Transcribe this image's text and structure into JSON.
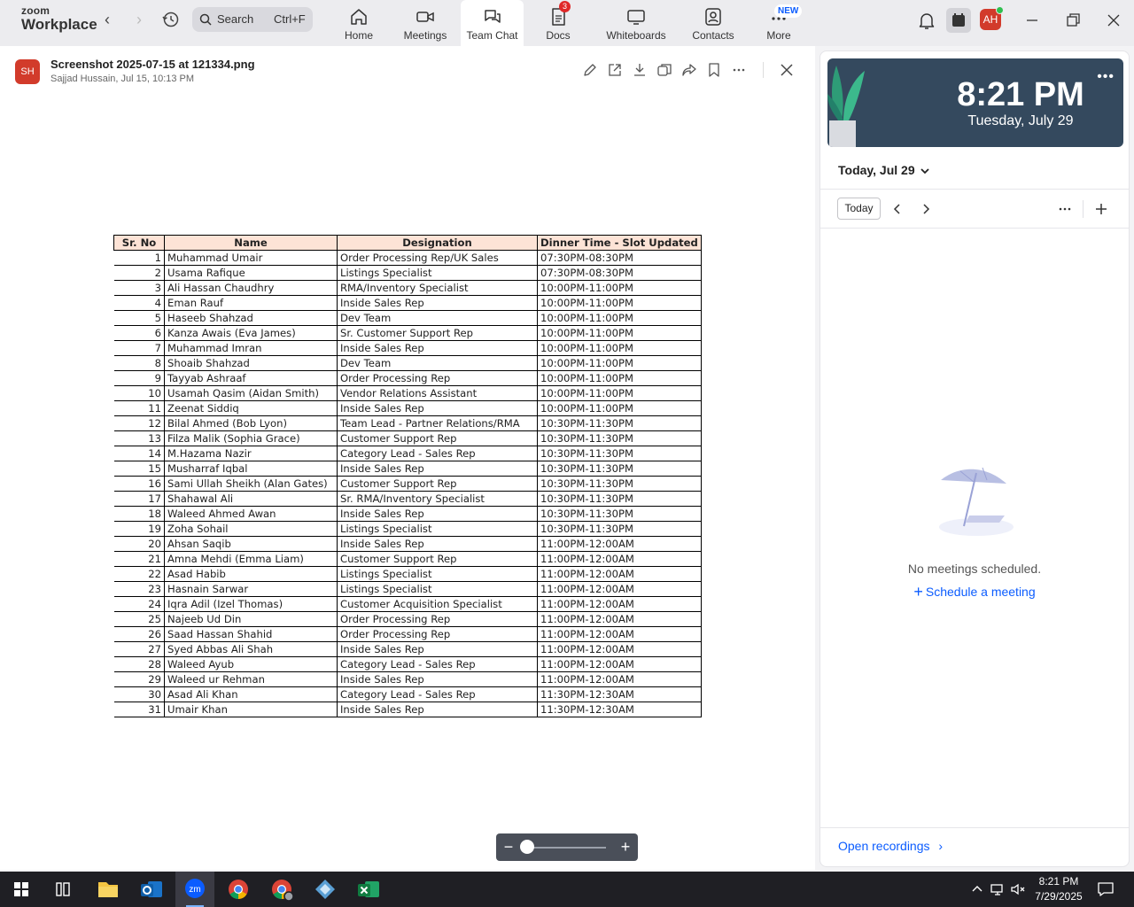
{
  "app": {
    "logo_line1": "zoom",
    "logo_line2": "Workplace",
    "search_placeholder": "Search",
    "search_shortcut": "Ctrl+F",
    "tabs": [
      {
        "label": "Home",
        "icon": "home-icon"
      },
      {
        "label": "Meetings",
        "icon": "video-camera-icon"
      },
      {
        "label": "Team Chat",
        "icon": "chat-bubbles-icon",
        "active": true
      },
      {
        "label": "Docs",
        "icon": "docs-icon",
        "badge": "3"
      },
      {
        "label": "Whiteboards",
        "icon": "whiteboard-icon"
      },
      {
        "label": "Contacts",
        "icon": "contacts-icon"
      },
      {
        "label": "More",
        "icon": "more-dots-icon",
        "badge": "NEW"
      }
    ],
    "user_initials": "AH",
    "accent": "#0b5cff"
  },
  "viewer": {
    "sender_initials": "SH",
    "file_name": "Screenshot 2025-07-15 at 121334.png",
    "file_meta": "Sajjad Hussain, Jul 15, 10:13 PM"
  },
  "table": {
    "headers": [
      "Sr. No",
      "Name",
      "Designation",
      "Dinner Time - Slot Updated"
    ],
    "rows": [
      [
        "1",
        "Muhammad Umair",
        "Order Processing Rep/UK Sales",
        "07:30PM-08:30PM"
      ],
      [
        "2",
        "Usama Rafique",
        "Listings Specialist",
        "07:30PM-08:30PM"
      ],
      [
        "3",
        "Ali Hassan Chaudhry",
        "RMA/Inventory Specialist",
        "10:00PM-11:00PM"
      ],
      [
        "4",
        "Eman Rauf",
        "Inside Sales Rep",
        "10:00PM-11:00PM"
      ],
      [
        "5",
        "Haseeb Shahzad",
        "Dev Team",
        "10:00PM-11:00PM"
      ],
      [
        "6",
        "Kanza Awais (Eva James)",
        "Sr. Customer Support Rep",
        "10:00PM-11:00PM"
      ],
      [
        "7",
        "Muhammad Imran",
        "Inside Sales Rep",
        "10:00PM-11:00PM"
      ],
      [
        "8",
        "Shoaib Shahzad",
        "Dev Team",
        "10:00PM-11:00PM"
      ],
      [
        "9",
        "Tayyab Ashraaf",
        "Order Processing Rep",
        "10:00PM-11:00PM"
      ],
      [
        "10",
        "Usamah Qasim (Aidan Smith)",
        "Vendor Relations Assistant",
        "10:00PM-11:00PM"
      ],
      [
        "11",
        "Zeenat Siddiq",
        "Inside Sales Rep",
        "10:00PM-11:00PM"
      ],
      [
        "12",
        "Bilal Ahmed (Bob Lyon)",
        "Team Lead - Partner Relations/RMA",
        "10:30PM-11:30PM"
      ],
      [
        "13",
        "Filza Malik (Sophia Grace)",
        "Customer Support Rep",
        "10:30PM-11:30PM"
      ],
      [
        "14",
        "M.Hazama Nazir",
        "Category Lead - Sales Rep",
        "10:30PM-11:30PM"
      ],
      [
        "15",
        "Musharraf Iqbal",
        "Inside Sales Rep",
        "10:30PM-11:30PM"
      ],
      [
        "16",
        "Sami Ullah Sheikh (Alan Gates)",
        "Customer Support Rep",
        "10:30PM-11:30PM"
      ],
      [
        "17",
        "Shahawal Ali",
        "Sr. RMA/Inventory Specialist",
        "10:30PM-11:30PM"
      ],
      [
        "18",
        "Waleed Ahmed Awan",
        "Inside Sales Rep",
        "10:30PM-11:30PM"
      ],
      [
        "19",
        "Zoha Sohail",
        "Listings Specialist",
        "10:30PM-11:30PM"
      ],
      [
        "20",
        "Ahsan Saqib",
        "Inside Sales Rep",
        "11:00PM-12:00AM"
      ],
      [
        "21",
        "Amna Mehdi (Emma Liam)",
        "Customer Support Rep",
        "11:00PM-12:00AM"
      ],
      [
        "22",
        "Asad Habib",
        "Listings Specialist",
        "11:00PM-12:00AM"
      ],
      [
        "23",
        "Hasnain Sarwar",
        "Listings Specialist",
        "11:00PM-12:00AM"
      ],
      [
        "24",
        "Iqra Adil (Izel Thomas)",
        "Customer Acquisition Specialist",
        "11:00PM-12:00AM"
      ],
      [
        "25",
        "Najeeb Ud Din",
        "Order Processing Rep",
        "11:00PM-12:00AM"
      ],
      [
        "26",
        "Saad Hassan Shahid",
        "Order Processing Rep",
        "11:00PM-12:00AM"
      ],
      [
        "27",
        "Syed Abbas Ali Shah",
        "Inside Sales Rep",
        "11:00PM-12:00AM"
      ],
      [
        "28",
        "Waleed Ayub",
        "Category Lead - Sales Rep",
        "11:00PM-12:00AM"
      ],
      [
        "29",
        "Waleed ur Rehman",
        "Inside Sales Rep",
        "11:00PM-12:00AM"
      ],
      [
        "30",
        "Asad Ali Khan",
        "Category Lead - Sales Rep",
        "11:30PM-12:30AM"
      ],
      [
        "31",
        "Umair Khan",
        "Inside Sales Rep",
        "11:30PM-12:30AM"
      ]
    ]
  },
  "calendar": {
    "time": "8:21 PM",
    "date": "Tuesday, July 29",
    "day_label": "Today, Jul 29",
    "today_button": "Today",
    "empty_text": "No meetings scheduled.",
    "schedule_link": "Schedule a meeting",
    "recordings_link": "Open recordings"
  },
  "taskbar": {
    "apps": [
      "windows-start-icon",
      "task-view-icon",
      "file-explorer-icon",
      "outlook-icon",
      "zoom-icon",
      "chrome-icon",
      "chrome-profile-icon",
      "app-diamond-icon",
      "excel-icon"
    ],
    "time": "8:21 PM",
    "date": "7/29/2025"
  }
}
